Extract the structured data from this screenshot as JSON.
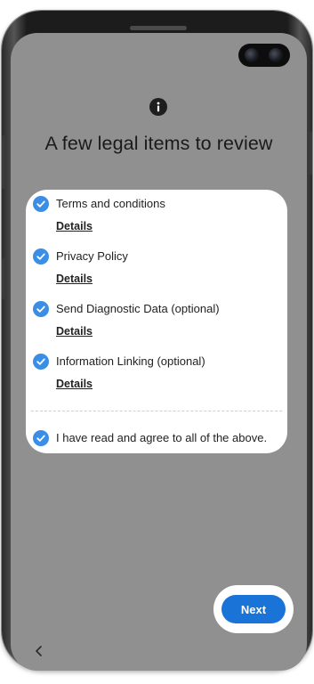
{
  "screen": {
    "title": "A few legal items to review",
    "info_icon": "info-icon",
    "background_color": "#909090"
  },
  "legal_items": [
    {
      "label": "Terms and conditions",
      "details_label": "Details",
      "checked": true
    },
    {
      "label": "Privacy Policy",
      "details_label": "Details",
      "checked": true
    },
    {
      "label": "Send Diagnostic Data (optional)",
      "details_label": "Details",
      "checked": true
    },
    {
      "label": "Information Linking (optional)",
      "details_label": "Details",
      "checked": true
    }
  ],
  "agree_all": {
    "label": "I have read and agree to all of the above.",
    "checked": true
  },
  "next_button": {
    "label": "Next",
    "color": "#1a73d6"
  },
  "nav": {
    "back_icon": "chevron-left-icon"
  },
  "colors": {
    "check": "#3a8ee6",
    "card": "#ffffff"
  }
}
